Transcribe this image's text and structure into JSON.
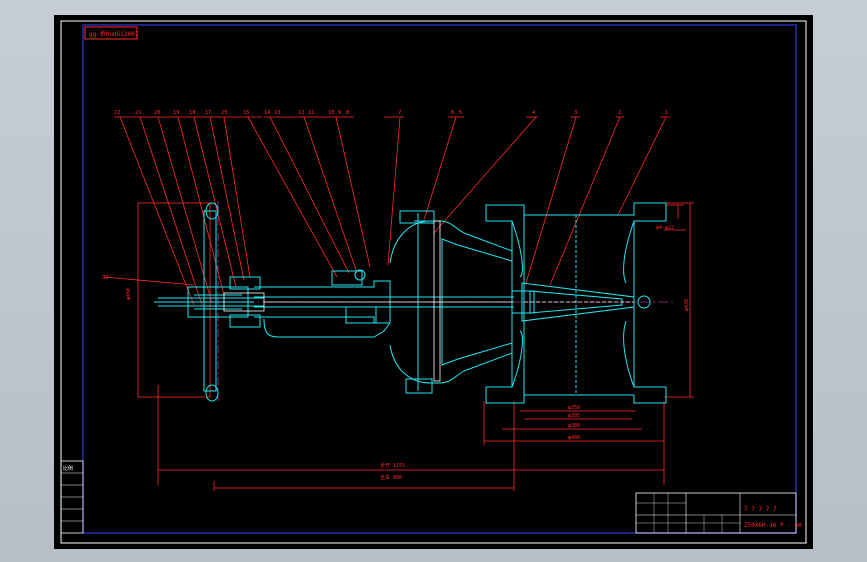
{
  "drawing": {
    "code_box": "gg-桥hudGi2007",
    "part_numbers": [
      "22",
      "21",
      "20",
      "19",
      "18",
      "17",
      "25",
      "15",
      "14",
      "13",
      "12",
      "11",
      "10",
      "9",
      "8",
      "7",
      "6",
      "5",
      "4",
      "3",
      "2",
      "1"
    ],
    "part_number_left": "33",
    "dims": {
      "left_height": "φ450",
      "right_height": "φ430",
      "flange_small": "φ4-φ22",
      "bottom": [
        "φ350",
        "φ395",
        "φ380",
        "φ480"
      ],
      "overall_open": "全开 1155",
      "overall_closed": "全关 880"
    },
    "title_block": {
      "text_a": "7 7 7 7 7",
      "text_b": "Z50X6H-16 P - 60"
    },
    "left_strip": [
      "比例",
      "",
      "",
      "",
      "",
      ""
    ]
  },
  "colors": {
    "canvas": "#000000",
    "frame": "#2b3bd8",
    "red": "#ff2a2a",
    "cyan": "#22e6f0",
    "white": "#ffffff",
    "magenta": "#ff3cf0"
  }
}
